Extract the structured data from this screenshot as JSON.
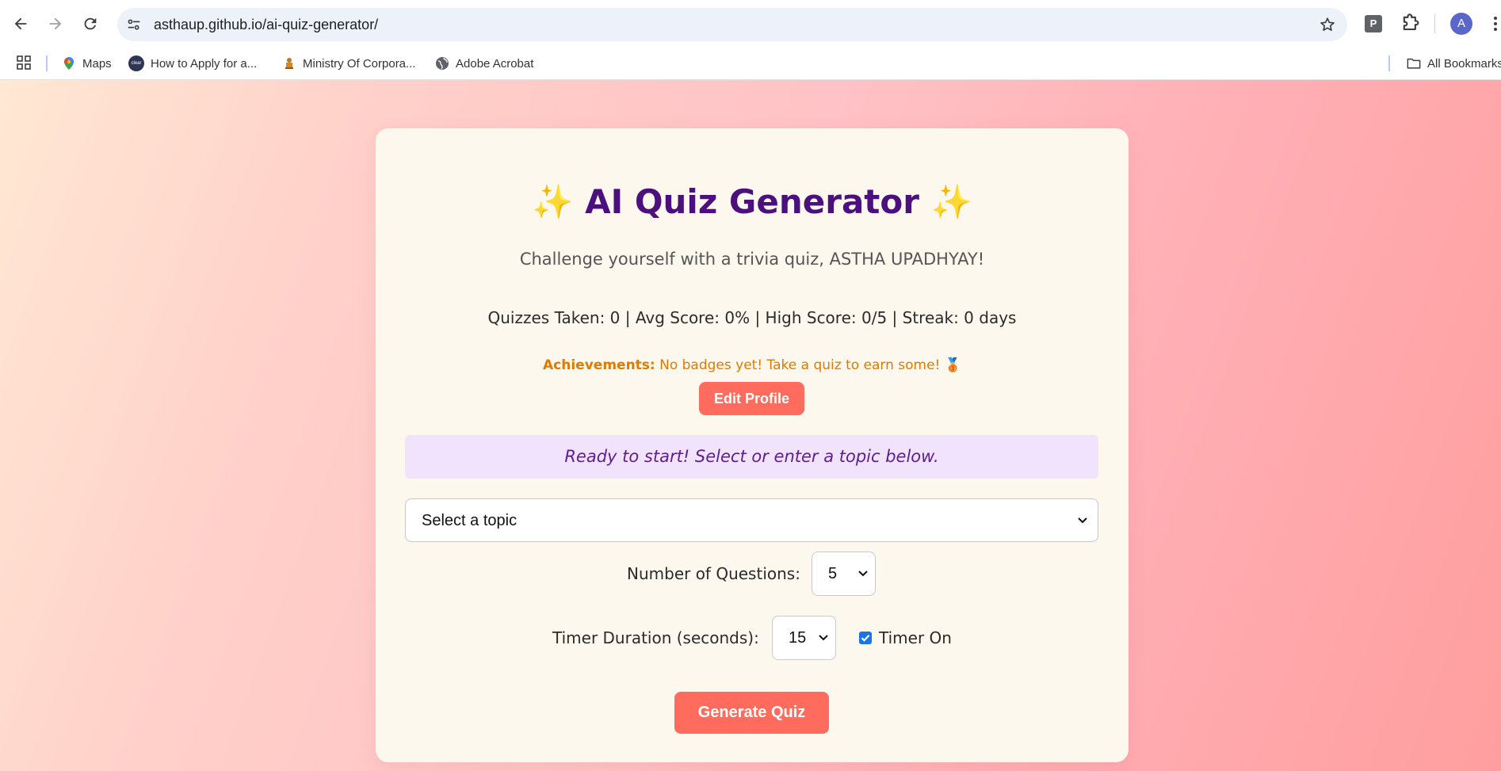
{
  "browser": {
    "url": "asthaup.github.io/ai-quiz-generator/",
    "extension_letter": "P",
    "avatar_letter": "A",
    "bookmarks": [
      {
        "label": "Maps",
        "icon": "maps-pin-icon"
      },
      {
        "label": "How to Apply for a...",
        "icon": "clear-logo-icon"
      },
      {
        "label": "Ministry Of Corpora...",
        "icon": "emblem-icon"
      },
      {
        "label": "Adobe Acrobat",
        "icon": "globe-icon"
      }
    ],
    "all_bookmarks_label": "All Bookmarks"
  },
  "app": {
    "title": "AI Quiz Generator",
    "sparkle": "✨",
    "subtitle": "Challenge yourself with a trivia quiz, ASTHA UPADHYAY!",
    "stats": "Quizzes Taken: 0 | Avg Score: 0% | High Score: 0/5 | Streak: 0 days",
    "achievements_label": "Achievements:",
    "achievements_text": " No badges yet! Take a quiz to earn some! 🥉",
    "edit_profile_label": "Edit Profile",
    "status_message": "Ready to start! Select or enter a topic below.",
    "topic_select_value": "Select a topic",
    "num_questions_label": "Number of Questions:",
    "num_questions_value": "5",
    "timer_label": "Timer Duration (seconds):",
    "timer_value": "15",
    "timer_on_label": "Timer On",
    "timer_on_checked": true,
    "generate_label": "Generate Quiz"
  },
  "colors": {
    "accent_button": "#ff6b5c",
    "title": "#4b0f7e",
    "achievements": "#e07a00",
    "status_bg": "#f1e3fb"
  }
}
